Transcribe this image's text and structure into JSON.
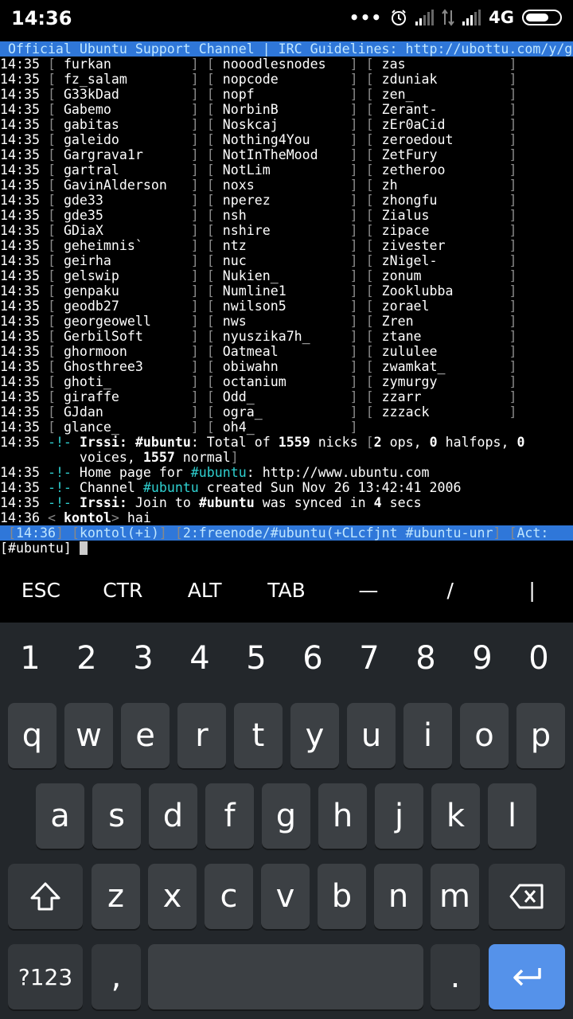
{
  "status_bar": {
    "time": "14:36",
    "network": "4G",
    "icons": [
      "dots-icon",
      "alarm-icon",
      "signal-icon",
      "data-icon",
      "signal-icon",
      "battery-icon"
    ]
  },
  "terminal": {
    "topic": " Official Ubuntu Support Channel | IRC Guidelines: http://ubottu.com/y/g",
    "nick_rows": [
      {
        "time": "14:35",
        "c1": "furkan",
        "c2": "nooodlesnodes",
        "c3": "zas"
      },
      {
        "time": "14:35",
        "c1": "fz_salam",
        "c2": "nopcode",
        "c3": "zduniak"
      },
      {
        "time": "14:35",
        "c1": "G33kDad",
        "c2": "nopf",
        "c3": "zen_"
      },
      {
        "time": "14:35",
        "c1": "Gabemo",
        "c2": "NorbinB",
        "c3": "Zerant-"
      },
      {
        "time": "14:35",
        "c1": "gabitas",
        "c2": "Noskcaj",
        "c3": "zEr0aCid"
      },
      {
        "time": "14:35",
        "c1": "galeido",
        "c2": "Nothing4You",
        "c3": "zeroedout"
      },
      {
        "time": "14:35",
        "c1": "Gargrava1r",
        "c2": "NotInTheMood",
        "c3": "ZetFury"
      },
      {
        "time": "14:35",
        "c1": "gartral",
        "c2": "NotLim",
        "c3": "zetheroo"
      },
      {
        "time": "14:35",
        "c1": "GavinAlderson",
        "c2": "noxs",
        "c3": "zh"
      },
      {
        "time": "14:35",
        "c1": "gde33",
        "c2": "nperez",
        "c3": "zhongfu"
      },
      {
        "time": "14:35",
        "c1": "gde35",
        "c2": "nsh",
        "c3": "Zialus"
      },
      {
        "time": "14:35",
        "c1": "GDiaX",
        "c2": "nshire",
        "c3": "zipace"
      },
      {
        "time": "14:35",
        "c1": "geheimnis`",
        "c2": "ntz",
        "c3": "zivester"
      },
      {
        "time": "14:35",
        "c1": "geirha",
        "c2": "nuc",
        "c3": "zNigel-"
      },
      {
        "time": "14:35",
        "c1": "gelswip",
        "c2": "Nukien_",
        "c3": "zonum"
      },
      {
        "time": "14:35",
        "c1": "genpaku",
        "c2": "Numline1",
        "c3": "Zooklubba"
      },
      {
        "time": "14:35",
        "c1": "geodb27",
        "c2": "nwilson5",
        "c3": "zorael"
      },
      {
        "time": "14:35",
        "c1": "georgeowell",
        "c2": "nws",
        "c3": "Zren"
      },
      {
        "time": "14:35",
        "c1": "GerbilSoft",
        "c2": "nyuszika7h_",
        "c3": "ztane"
      },
      {
        "time": "14:35",
        "c1": "ghormoon",
        "c2": "Oatmeal",
        "c3": "zululee"
      },
      {
        "time": "14:35",
        "c1": "Ghosthree3",
        "c2": "obiwahn",
        "c3": "zwamkat_"
      },
      {
        "time": "14:35",
        "c1": "ghoti_",
        "c2": "octanium",
        "c3": "zymurgy"
      },
      {
        "time": "14:35",
        "c1": "giraffe",
        "c2": "Odd_",
        "c3": "zzarr"
      },
      {
        "time": "14:35",
        "c1": "GJdan",
        "c2": "ogra_",
        "c3": "zzzack"
      },
      {
        "time": "14:35",
        "c1": "glance_",
        "c2": "oh4_",
        "c3": ""
      }
    ],
    "msg_total": {
      "time": "14:35",
      "marker": "-!-",
      "client": "Irssi:",
      "channel": "#ubuntu",
      "text1": ": Total of ",
      "total": "1559",
      "text2": " nicks ",
      "ops": "2",
      "ops_label": " ops, ",
      "halfops": "0",
      "halfops_label": " halfops, ",
      "zero": "0",
      "line2_voices": "voices, ",
      "normal": "1557",
      "normal_label": " normal"
    },
    "msg_homepage": {
      "time": "14:35",
      "marker": "-!-",
      "pre": " Home page for ",
      "channel": "#ubuntu",
      "post": ": http://www.ubuntu.com"
    },
    "msg_created": {
      "time": "14:35",
      "marker": "-!-",
      "pre": " Channel ",
      "channel": "#ubuntu",
      "post": " created Sun Nov 26 13:42:41 2006"
    },
    "msg_synced": {
      "time": "14:35",
      "marker": "-!-",
      "client": "Irssi:",
      "pre": " Join to ",
      "channel": "#ubuntu",
      "mid": " was synced in ",
      "secs": "4",
      "post": " secs"
    },
    "msg_chat": {
      "time": "14:36",
      "nick": "kontol",
      "text": " hai"
    },
    "statusline": {
      "time": "14:36",
      "nick": "kontol(+i)",
      "window": "2:freenode/#ubuntu(+CLcfjnt #ubuntu-unr",
      "act": "Act:"
    },
    "prompt": "[#ubuntu] "
  },
  "extra_keys": [
    "ESC",
    "CTR",
    "ALT",
    "TAB",
    "—",
    "/",
    "|"
  ],
  "keyboard": {
    "numbers": [
      "1",
      "2",
      "3",
      "4",
      "5",
      "6",
      "7",
      "8",
      "9",
      "0"
    ],
    "row1": [
      "q",
      "w",
      "e",
      "r",
      "t",
      "y",
      "u",
      "i",
      "o",
      "p"
    ],
    "row2": [
      "a",
      "s",
      "d",
      "f",
      "g",
      "h",
      "j",
      "k",
      "l"
    ],
    "row3": [
      "z",
      "x",
      "c",
      "v",
      "b",
      "n",
      "m"
    ],
    "symbols_label": "?123",
    "comma": ",",
    "period": "."
  }
}
